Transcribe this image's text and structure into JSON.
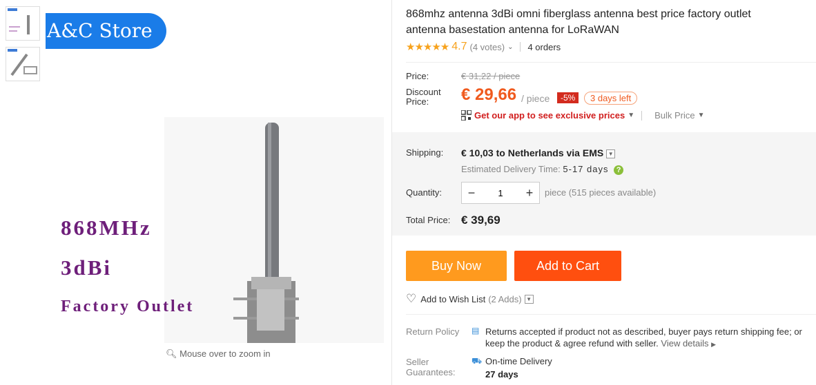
{
  "store": {
    "name": "A&C Store"
  },
  "image": {
    "overlay_lines": [
      "868MHz",
      "3dBi",
      "Factory Outlet"
    ],
    "zoom_hint": "Mouse over to zoom in"
  },
  "product": {
    "title": "868mhz antenna 3dBi omni fiberglass antenna best price factory outlet antenna basestation antenna for LoRaWAN",
    "rating": "4.7",
    "votes": "(4 votes)",
    "orders": "4 orders"
  },
  "pricing": {
    "price_label": "Price:",
    "original_price": "€ 31,22 / piece",
    "discount_label": "Discount Price:",
    "discount_price": "€ 29,66",
    "per_piece": "/ piece",
    "discount_pct": "-5%",
    "days_left": "3 days left",
    "app_promo": "Get our app to see exclusive prices",
    "bulk_price": "Bulk Price"
  },
  "shipping": {
    "label": "Shipping:",
    "value": "€ 10,03 to Netherlands via EMS",
    "estimated_label": "Estimated Delivery Time:",
    "estimated_days": "5-17 days"
  },
  "quantity": {
    "label": "Quantity:",
    "value": "1",
    "available": "piece (515 pieces available)"
  },
  "total": {
    "label": "Total Price:",
    "value": "€ 39,69"
  },
  "actions": {
    "buy_now": "Buy Now",
    "add_to_cart": "Add to Cart",
    "wish_list": "Add to Wish List",
    "wish_count": "(2 Adds)"
  },
  "policy": {
    "return_label": "Return Policy",
    "return_text": "Returns accepted if product not as described, buyer pays return shipping fee; or keep the product & agree refund with seller.",
    "view_details": "View details",
    "guarantee_label": "Seller Guarantees:",
    "guarantee_text": "On-time Delivery",
    "guarantee_days": "27 days"
  },
  "colors": {
    "accent_orange": "#f05a1e",
    "buy_now": "#ff9a1e",
    "add_to_cart": "#ff4f0f",
    "store_badge": "#1a7ce8",
    "star": "#f7a21c"
  },
  "icons": [
    "search-icon",
    "qr-code-icon",
    "heart-icon",
    "refund-icon",
    "truck-icon",
    "question-icon",
    "chevron-down-icon"
  ]
}
